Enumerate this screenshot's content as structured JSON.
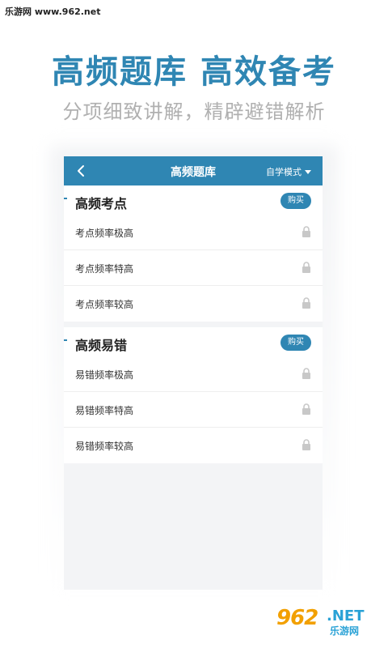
{
  "watermark_top": "乐游网 www.962.net",
  "headline": "高频题库 高效备考",
  "subline": "分项细致讲解，精辟避错解析",
  "app": {
    "title": "高频题库",
    "mode_label": "自学模式",
    "accent": "#2f86b3"
  },
  "sections": [
    {
      "title": "高频考点",
      "buy_label": "购买",
      "items": [
        {
          "label": "考点频率极高",
          "icon": "lock-icon"
        },
        {
          "label": "考点频率特高",
          "icon": "lock-icon"
        },
        {
          "label": "考点频率较高",
          "icon": "lock-icon"
        }
      ]
    },
    {
      "title": "高频易错",
      "buy_label": "购买",
      "items": [
        {
          "label": "易错频率极高",
          "icon": "lock-icon"
        },
        {
          "label": "易错频率特高",
          "icon": "lock-icon"
        },
        {
          "label": "易错频率较高",
          "icon": "lock-icon"
        }
      ]
    }
  ],
  "watermark_bottom": {
    "number": "962",
    "net": ".NET",
    "cn": "乐游网"
  }
}
